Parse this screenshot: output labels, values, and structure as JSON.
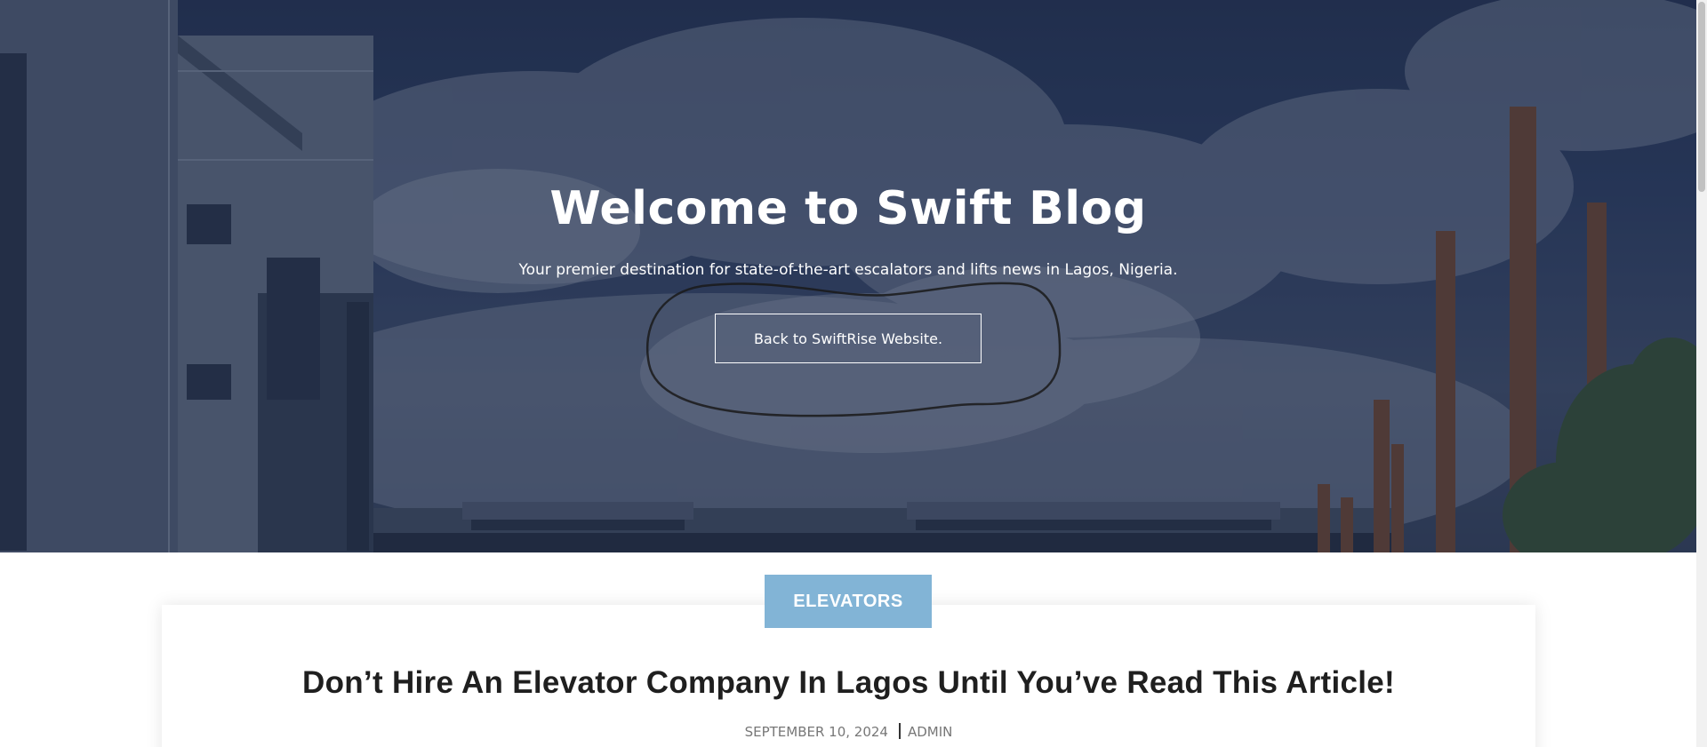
{
  "hero": {
    "title": "Welcome to Swift Blog",
    "subtitle": "Your premier destination for state-of-the-art escalators and lifts news in Lagos, Nigeria.",
    "button_label": "Back to SwiftRise Website."
  },
  "post": {
    "category": "ELEVATORS",
    "title": "Don’t Hire An Elevator Company In Lagos Until You’ve Read This Article!",
    "date": "SEPTEMBER 10, 2024",
    "author": "ADMIN"
  },
  "colors": {
    "badge": "#82b4d6",
    "overlay": "#1c2b4a",
    "title_text": "#1f1f1f",
    "meta_text": "#777777"
  }
}
